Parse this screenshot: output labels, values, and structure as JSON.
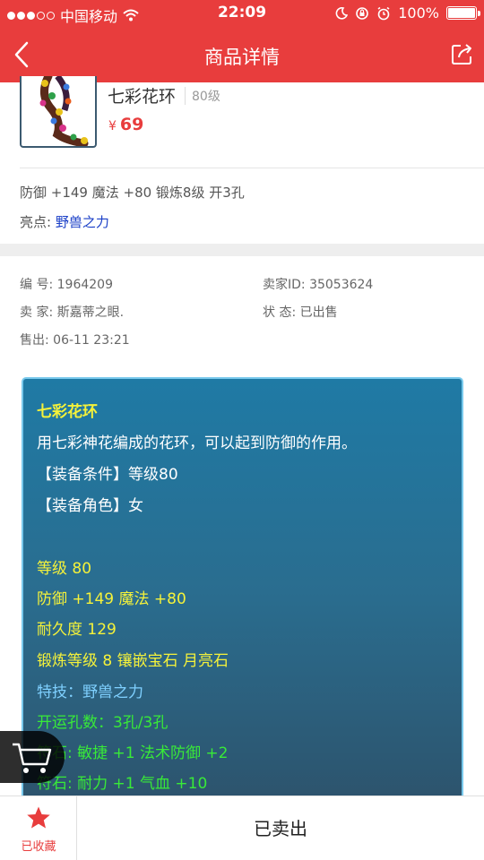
{
  "status_bar": {
    "carrier": "中国移动",
    "time": "22:09",
    "battery": "100%"
  },
  "nav": {
    "title": "商品详情"
  },
  "item": {
    "name": "七彩花环",
    "level": "80级",
    "price_symbol": "¥",
    "price": "69",
    "stats": "防御 +149 魔法 +80 锻炼8级 开3孔",
    "highlight_label": "亮点: ",
    "highlight_value": "野兽之力"
  },
  "info": {
    "id_label": "编  号: ",
    "id_value": "1964209",
    "seller_id_label": "卖家ID: ",
    "seller_id_value": "35053624",
    "seller_label": "卖  家: ",
    "seller_value": "斯嘉蒂之眼.",
    "state_label": "状  态: ",
    "state_value": "已出售",
    "sold_label": "售出: ",
    "sold_value": "06-11 23:21"
  },
  "card": {
    "title": "七彩花环",
    "desc": "用七彩神花编成的花环，可以起到防御的作用。",
    "cond1": "【装备条件】等级80",
    "cond2": "【装备角色】女",
    "level": "等级 80",
    "attr": "防御 +149 魔法 +80",
    "durability": "耐久度 129",
    "forge": "锻炼等级 8 镶嵌宝石 月亮石",
    "skill": "特技：野兽之力",
    "holes": "开运孔数：3孔/3孔",
    "rune1": "符石: 敏捷 +1 法术防御 +2",
    "rune2": "符石: 耐力 +1 气血 +10"
  },
  "bottom": {
    "fav_label": "已收藏",
    "sold_label": "已卖出"
  },
  "colors": {
    "brand_red": "#e83d3d",
    "highlight_blue": "#1a3fc7"
  }
}
